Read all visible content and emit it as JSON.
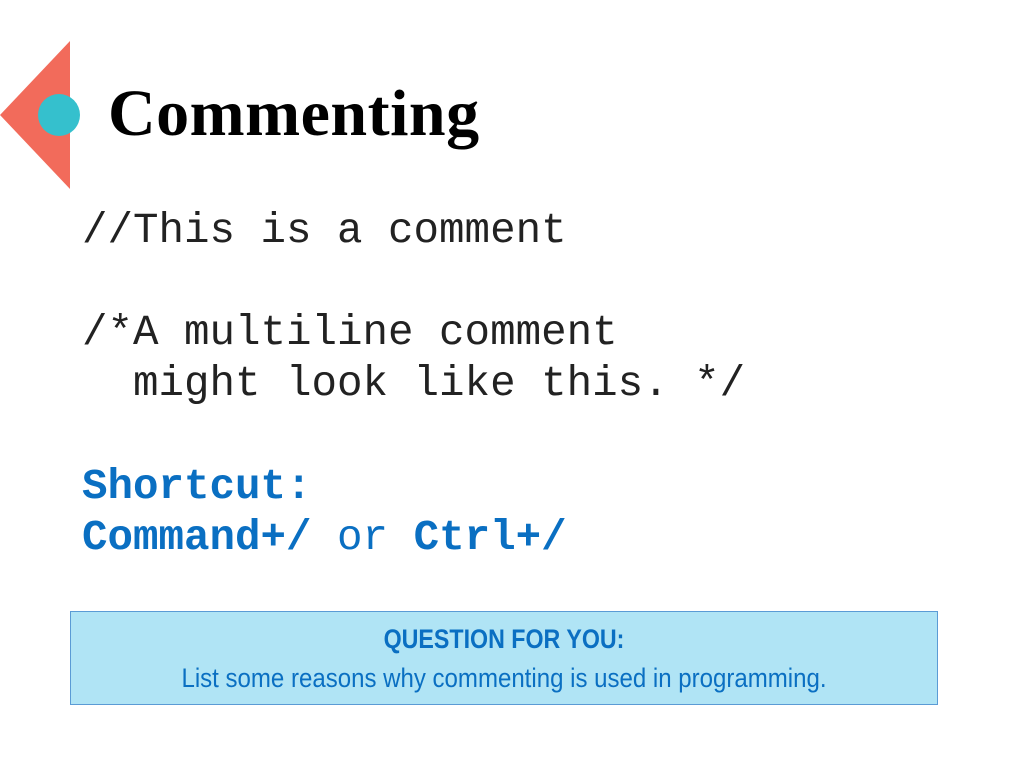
{
  "slide": {
    "title": "Commenting",
    "decoration": {
      "triangle_color": "#F26B5B",
      "circle_color": "#35C0CD"
    },
    "code_lines": [
      "//This is a comment",
      "/*A multiline comment",
      "  might look like this. */"
    ],
    "shortcut": {
      "heading": "Shortcut:",
      "mac": "Command+/",
      "separator": " or ",
      "windows": "Ctrl+/"
    },
    "question_box": {
      "title": "QUESTION FOR YOU:",
      "text": "List some reasons why commenting is used in programming.",
      "fill_color": "#B0E4F5",
      "border_color": "#5B9BD5",
      "text_color": "#0A6FC2"
    }
  }
}
